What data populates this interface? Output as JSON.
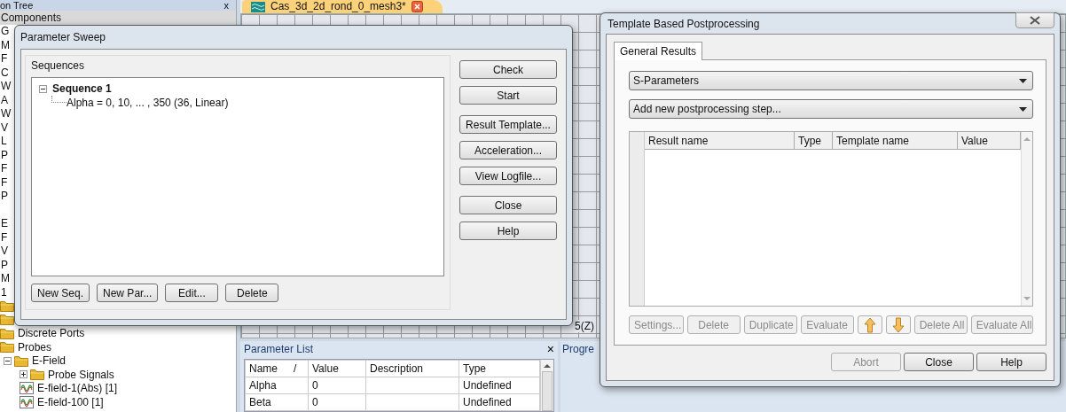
{
  "project_tree": {
    "title": "on Tree",
    "close_glyph": "x",
    "items": [
      {
        "kind": "text",
        "label": "Components",
        "selected": true
      },
      {
        "kind": "text",
        "label": "G",
        "selected": false
      },
      {
        "kind": "text",
        "label": "M",
        "selected": false
      },
      {
        "kind": "text",
        "label": "F",
        "selected": false
      },
      {
        "kind": "text",
        "label": "C",
        "selected": false
      },
      {
        "kind": "text",
        "label": "W",
        "selected": false
      },
      {
        "kind": "text",
        "label": "A",
        "selected": false
      },
      {
        "kind": "text",
        "label": "W",
        "selected": false
      },
      {
        "kind": "text",
        "label": "V",
        "selected": false
      },
      {
        "kind": "text",
        "label": "L",
        "selected": false
      },
      {
        "kind": "text",
        "label": "P",
        "selected": false
      },
      {
        "kind": "text",
        "label": "F",
        "selected": false
      },
      {
        "kind": "text",
        "label": "F",
        "selected": false
      },
      {
        "kind": "text",
        "label": "P",
        "selected": false
      },
      {
        "kind": "gap",
        "selected": false
      },
      {
        "kind": "text",
        "label": "E",
        "selected": false
      },
      {
        "kind": "text",
        "label": "F",
        "selected": false
      },
      {
        "kind": "text",
        "label": "V",
        "selected": false
      },
      {
        "kind": "text",
        "label": "P",
        "selected": false
      },
      {
        "kind": "text",
        "label": "M",
        "selected": false
      },
      {
        "kind": "text",
        "label": "1",
        "selected": false
      },
      {
        "kind": "folder",
        "selected": false
      },
      {
        "kind": "folder",
        "selected": false
      },
      {
        "kind": "folder",
        "label": "Discrete Ports",
        "selected": false
      },
      {
        "kind": "folder",
        "label": "Probes",
        "selected": false,
        "children": [
          {
            "kind": "folder",
            "label": "E-Field",
            "selected": false,
            "expanded": true,
            "children": [
              {
                "kind": "folder",
                "label": "Probe Signals",
                "selected": false,
                "expanded": false
              },
              {
                "kind": "signal",
                "label": "E-field-1(Abs) [1]",
                "selected": false
              },
              {
                "kind": "signal",
                "label": "E-field-100 [1]",
                "selected": false
              }
            ]
          }
        ]
      }
    ]
  },
  "document_tab": {
    "title": "Cas_3d_2d_rond_0_mesh3*",
    "selected": true
  },
  "view": {
    "axis_label": "5(Z)"
  },
  "parameter_sweep": {
    "title": "Parameter Sweep",
    "group_label": "Sequences",
    "sequences": [
      {
        "label": "Sequence 1",
        "expanded": true,
        "children": [
          {
            "label": "Alpha = 0, 10, ... , 350 (36, Linear)"
          }
        ]
      }
    ],
    "side_button_groups": [
      [
        "Check",
        "Start"
      ],
      [
        "Result Template...",
        "Acceleration...",
        "View Logfile..."
      ],
      [
        "Close",
        "Help"
      ]
    ],
    "bottom_buttons": [
      "New Seq.",
      "New Par...",
      "Edit...",
      "Delete"
    ]
  },
  "parameter_list": {
    "title": "Parameter List",
    "close_glyph": "×",
    "columns": [
      {
        "label": "Name",
        "sort_mark": "/"
      },
      {
        "label": "Value"
      },
      {
        "label": "Description"
      },
      {
        "label": "Type"
      }
    ],
    "rows": [
      {
        "name": "Alpha",
        "value": "0",
        "type": "Undefined"
      },
      {
        "name": "Beta",
        "value": "0",
        "type": "Undefined"
      }
    ]
  },
  "progress_panel": {
    "title": "Progre"
  },
  "template_postprocessing": {
    "title": "Template Based Postprocessing",
    "tabs": [
      {
        "label": "General Results",
        "selected": true
      }
    ],
    "result_type": {
      "value": "S-Parameters"
    },
    "step_select": {
      "value": "Add new postprocessing step..."
    },
    "table": {
      "columns": [
        "Result name",
        "Type",
        "Template name",
        "Value"
      ]
    },
    "actions": [
      {
        "kind": "text",
        "label": "Settings...",
        "disabled": true
      },
      {
        "kind": "text",
        "label": "Delete",
        "disabled": true
      },
      {
        "kind": "text",
        "label": "Duplicate",
        "disabled": true
      },
      {
        "kind": "text",
        "label": "Evaluate",
        "disabled": true
      },
      {
        "kind": "arrow-up",
        "disabled": false
      },
      {
        "kind": "arrow-down",
        "disabled": false
      },
      {
        "kind": "text",
        "label": "Delete All",
        "disabled": true
      },
      {
        "kind": "text",
        "label": "Evaluate All",
        "disabled": true
      }
    ],
    "footer_buttons": [
      {
        "label": "Abort",
        "disabled": true
      },
      {
        "label": "Close",
        "disabled": false
      },
      {
        "label": "Help",
        "disabled": false
      }
    ]
  }
}
